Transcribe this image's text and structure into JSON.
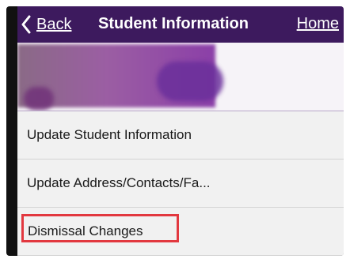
{
  "navbar": {
    "back_label": "Back",
    "title": "Student Information",
    "home_label": "Home",
    "background_color": "#3d1a5e"
  },
  "profile": {
    "redacted": true
  },
  "menu": {
    "items": [
      {
        "label": "Update Student Information"
      },
      {
        "label": "Update Address/Contacts/Fa..."
      },
      {
        "label": "Dismissal Changes",
        "highlighted": true
      }
    ],
    "highlight_color": "#e2383f"
  },
  "icons": {
    "back": "chevron-left-icon"
  }
}
